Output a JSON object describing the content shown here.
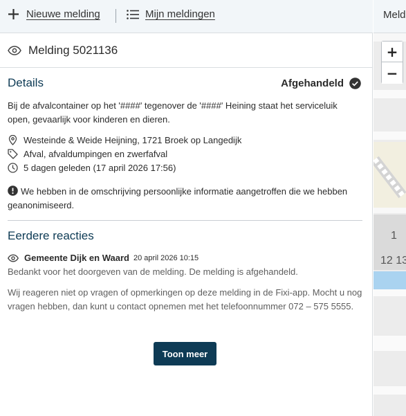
{
  "topbar": {
    "new_report": "Nieuwe melding",
    "my_reports": "Mijn meldingen"
  },
  "report": {
    "title": "Melding 5021136",
    "details_heading": "Details",
    "status": "Afgehandeld",
    "description": "Bij de afvalcontainer op het '####' tegenover de '####' Heining staat het serviceluik open, gevaarlijk voor kinderen en dieren.",
    "location": "Westeinde & Weide Heijning, 1721 Broek op Langedijk",
    "category": "Afval, afvaldumpingen en zwerfafval",
    "time": "5 dagen geleden (17 april 2026 17:56)",
    "notice": "We hebben in de omschrijving persoonlijke informatie aangetroffen die we hebben geanonimiseerd."
  },
  "replies": {
    "heading": "Eerdere reacties",
    "items": [
      {
        "author": "Gemeente Dijk en Waard",
        "date": "20 april 2026 10:15",
        "text1": "Bedankt voor het doorgeven van de melding. De melding is afgehandeld.",
        "text2": "Wij reageren niet op vragen of opmerkingen op deze melding in de Fixi-app. Mocht u nog vragen hebben, dan kunt u contact opnemen met het telefoonnummer 072 – 575 5555."
      }
    ],
    "more_button": "Toon meer"
  },
  "map": {
    "header_label": "Meld",
    "zoom_in": "+",
    "zoom_out": "−",
    "labels": [
      "1",
      "12 13"
    ]
  },
  "colors": {
    "accent": "#0e3b55",
    "topbar_bg": "#f2f6f9",
    "status_icon": "#333333"
  }
}
